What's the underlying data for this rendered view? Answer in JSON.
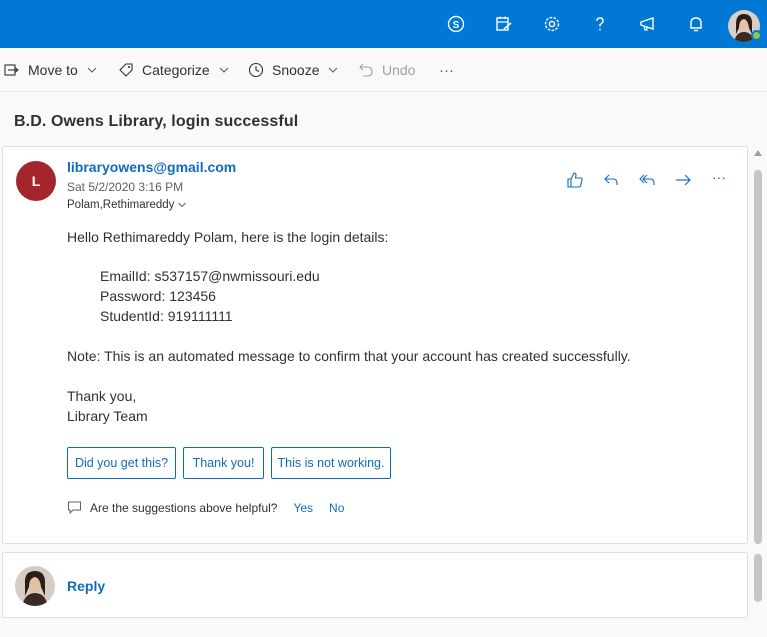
{
  "topbar": {
    "icons": [
      "skype-icon",
      "my-day-icon",
      "settings-icon",
      "help-icon",
      "feedback-icon",
      "notifications-icon"
    ],
    "accent": "#0078d4"
  },
  "toolbar": {
    "move_to": "Move to",
    "categorize": "Categorize",
    "snooze": "Snooze",
    "undo": "Undo",
    "more": "···"
  },
  "message": {
    "subject": "B.D. Owens Library, login successful",
    "sender_initial": "L",
    "from": "libraryowens@gmail.com",
    "date": "Sat 5/2/2020 3:16 PM",
    "to": "Polam,Rethimareddy",
    "greeting": "Hello Rethimareddy Polam, here is the login details:",
    "email_line": "EmailId: s537157@nwmissouri.edu",
    "password_line": "Password: 123456",
    "student_line": "StudentId: 919111111",
    "note": "Note: This is an automated message to confirm that your account has created successfully.",
    "thanks": "Thank you,",
    "signature": "Library Team",
    "more_actions": "···"
  },
  "suggestions": [
    "Did you get this?",
    "Thank you!",
    "This is not working."
  ],
  "feedback": {
    "question": "Are the suggestions above helpful?",
    "yes": "Yes",
    "no": "No"
  },
  "reply": {
    "label": "Reply"
  }
}
